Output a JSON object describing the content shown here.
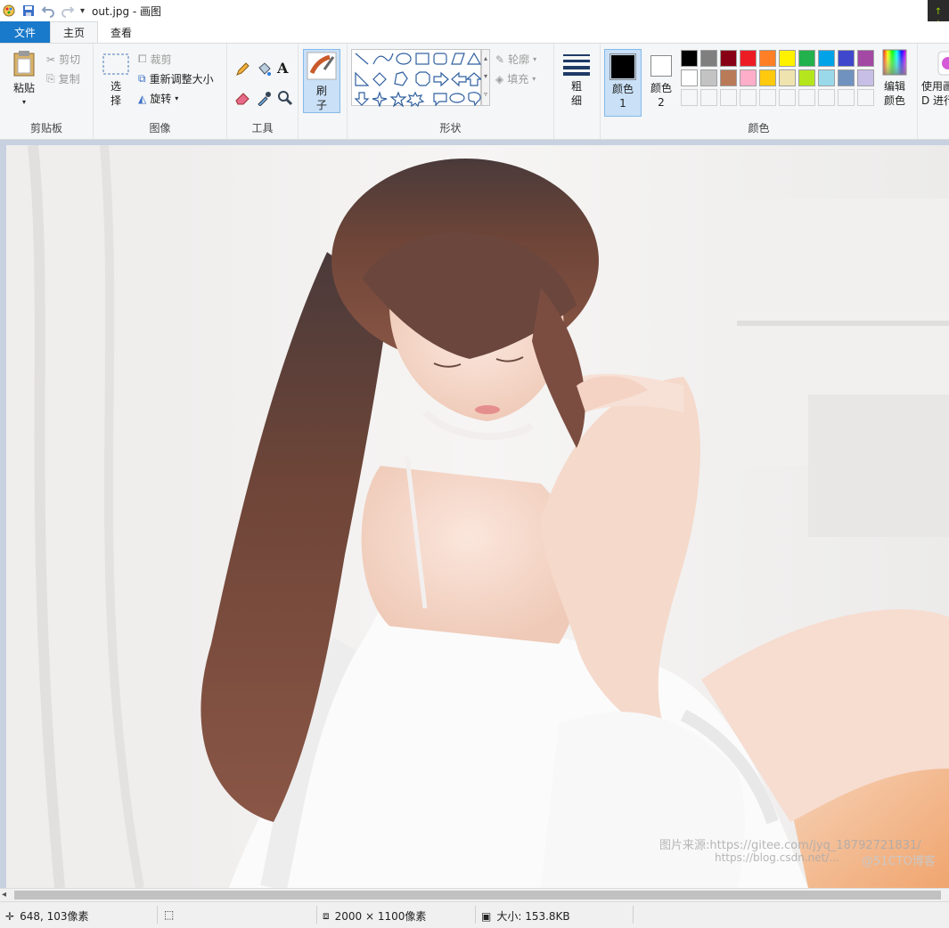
{
  "window": {
    "title": "out.jpg - 画图"
  },
  "tabs": {
    "file": "文件",
    "home": "主页",
    "view": "查看"
  },
  "ribbon": {
    "clipboard": {
      "paste": "粘贴",
      "cut": "剪切",
      "copy": "复制",
      "group": "剪贴板"
    },
    "image": {
      "select": "选择",
      "crop": "裁剪",
      "resize": "重新调整大小",
      "rotate": "旋转",
      "group": "图像"
    },
    "tools": {
      "group": "工具"
    },
    "brushes": {
      "label": "刷子"
    },
    "shapes": {
      "outline": "轮廓",
      "fill": "填充",
      "group": "形状"
    },
    "size": {
      "label": "粗细"
    },
    "colors": {
      "color1": "颜色 1",
      "color2": "颜色 2",
      "edit": "编辑颜色",
      "group": "颜色",
      "row1": [
        "#000000",
        "#7f7f7f",
        "#880015",
        "#ed1c24",
        "#ff7f27",
        "#fff200",
        "#22b14c",
        "#00a2e8",
        "#3f48cc",
        "#a349a4"
      ],
      "row2": [
        "#ffffff",
        "#c3c3c3",
        "#b97a57",
        "#ffaec9",
        "#ffc90e",
        "#efe4b0",
        "#b5e61d",
        "#99d9ea",
        "#7092be",
        "#c8bfe7"
      ]
    },
    "paint3d": {
      "label1": "使用画",
      "label2": "D 进行"
    }
  },
  "status": {
    "cursor": "648, 103像素",
    "dimensions": "2000 × 1100像素",
    "filesize": "大小: 153.8KB"
  },
  "watermark": {
    "line1": "图片来源:https://gitee.com/jyq_18792721831/",
    "line2": "https://blog.csdn.net/...",
    "line3": "@51CTO博客"
  }
}
